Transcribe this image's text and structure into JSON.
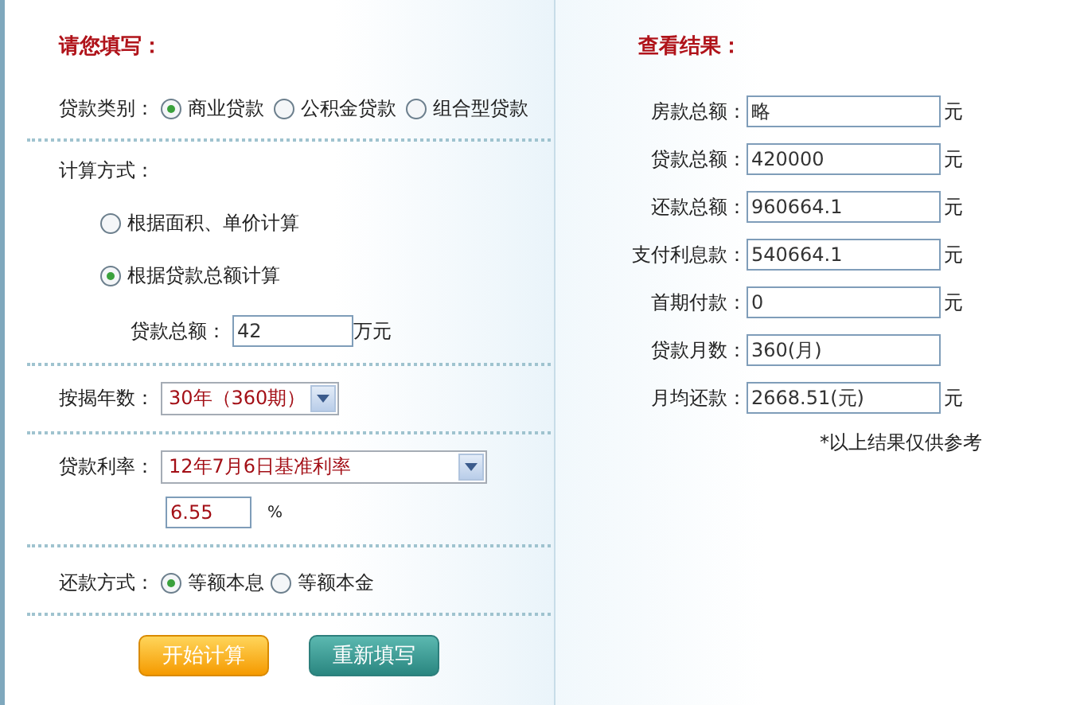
{
  "form": {
    "title": "请您填写：",
    "loan_type": {
      "label": "贷款类别：",
      "options": [
        {
          "label": "商业贷款",
          "selected": true
        },
        {
          "label": "公积金贷款",
          "selected": false
        },
        {
          "label": "组合型贷款",
          "selected": false
        }
      ]
    },
    "calc_method": {
      "label": "计算方式：",
      "options": [
        {
          "label": "根据面积、单价计算",
          "selected": false
        },
        {
          "label": "根据贷款总额计算",
          "selected": true
        }
      ]
    },
    "loan_amount": {
      "label": "贷款总额：",
      "value": "42",
      "unit": "万元"
    },
    "term": {
      "label": "按揭年数：",
      "value": "30年（360期）"
    },
    "rate": {
      "label": "贷款利率：",
      "value": "12年7月6日基准利率",
      "percent": "6.55",
      "unit": "%"
    },
    "repayment": {
      "label": "还款方式：",
      "options": [
        {
          "label": "等额本息",
          "selected": true
        },
        {
          "label": "等额本金",
          "selected": false
        }
      ]
    },
    "buttons": [
      {
        "label": "开始计算",
        "kind": "primary"
      },
      {
        "label": "重新填写",
        "kind": "secondary"
      }
    ]
  },
  "results": {
    "title": "查看结果：",
    "rows": [
      {
        "label": "房款总额：",
        "value": "略",
        "unit": "元"
      },
      {
        "label": "贷款总额：",
        "value": "420000",
        "unit": "元"
      },
      {
        "label": "还款总额：",
        "value": "960664.1",
        "unit": "元"
      },
      {
        "label": "支付利息款：",
        "value": "540664.1",
        "unit": "元"
      },
      {
        "label": "首期付款：",
        "value": "0",
        "unit": "元"
      },
      {
        "label": "贷款月数：",
        "value": "360(月)"
      },
      {
        "label": "月均还款：",
        "value": "2668.51(元)",
        "unit": "元"
      }
    ],
    "note": "*以上结果仅供参考"
  }
}
